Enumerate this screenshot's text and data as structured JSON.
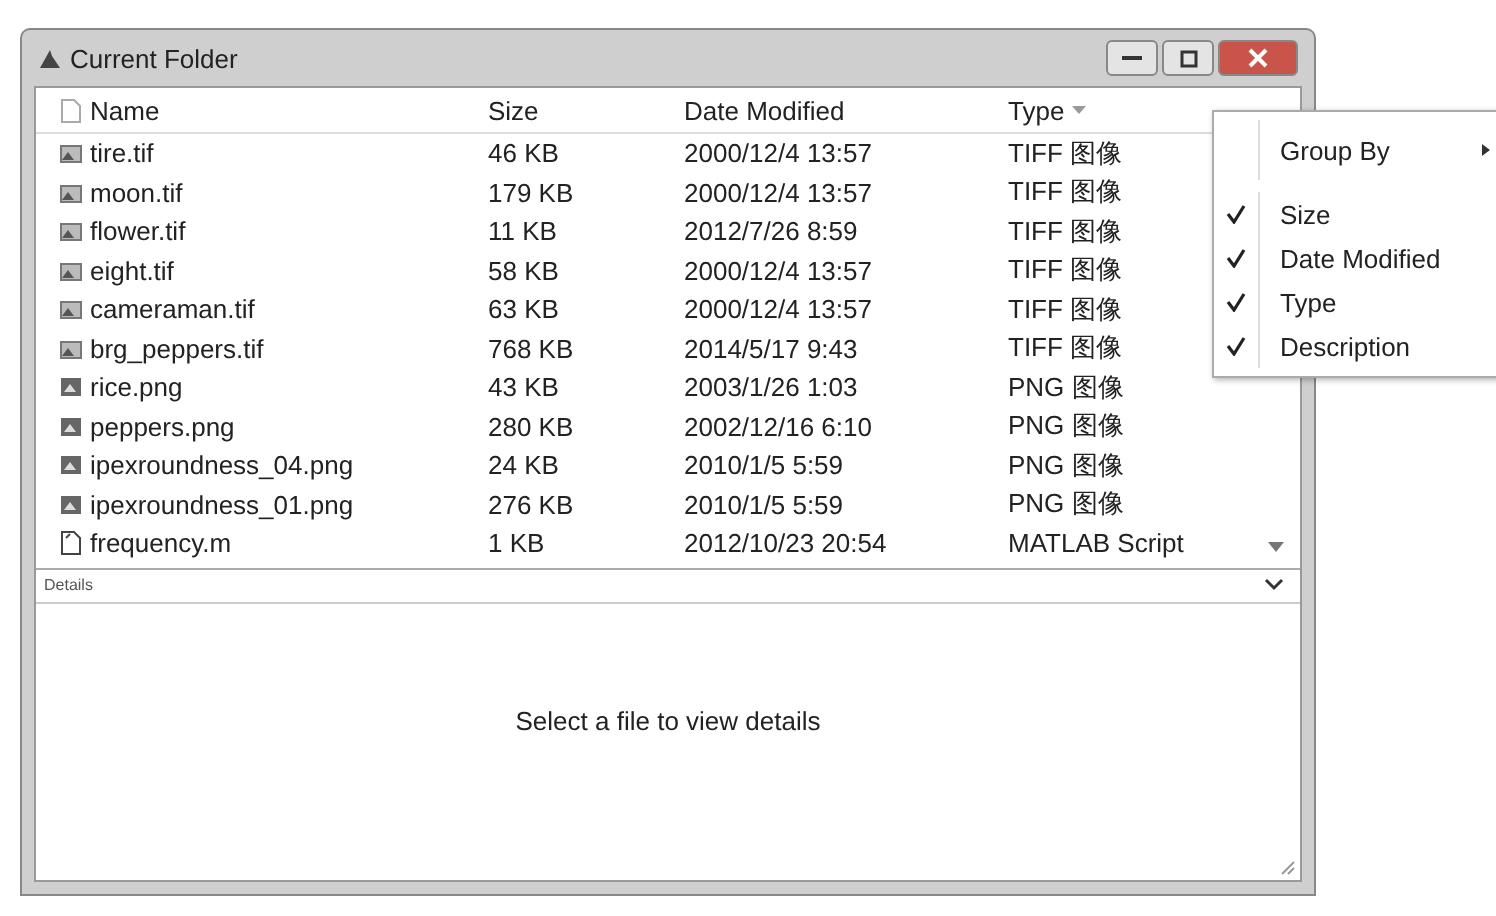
{
  "window": {
    "title": "Current Folder"
  },
  "table": {
    "columns": [
      "Name",
      "Size",
      "Date Modified",
      "Type"
    ],
    "rows": [
      {
        "kind": "tif",
        "name": "tire.tif",
        "size": "46 KB",
        "date": "2000/12/4 13:57",
        "type": "TIFF 图像"
      },
      {
        "kind": "tif",
        "name": "moon.tif",
        "size": "179 KB",
        "date": "2000/12/4 13:57",
        "type": "TIFF 图像"
      },
      {
        "kind": "tif",
        "name": "flower.tif",
        "size": "11 KB",
        "date": "2012/7/26 8:59",
        "type": "TIFF 图像"
      },
      {
        "kind": "tif",
        "name": "eight.tif",
        "size": "58 KB",
        "date": "2000/12/4 13:57",
        "type": "TIFF 图像"
      },
      {
        "kind": "tif",
        "name": "cameraman.tif",
        "size": "63 KB",
        "date": "2000/12/4 13:57",
        "type": "TIFF 图像"
      },
      {
        "kind": "tif",
        "name": "brg_peppers.tif",
        "size": "768 KB",
        "date": "2014/5/17 9:43",
        "type": "TIFF 图像"
      },
      {
        "kind": "png",
        "name": "rice.png",
        "size": "43 KB",
        "date": "2003/1/26 1:03",
        "type": "PNG 图像"
      },
      {
        "kind": "png",
        "name": "peppers.png",
        "size": "280 KB",
        "date": "2002/12/16 6:10",
        "type": "PNG 图像"
      },
      {
        "kind": "png",
        "name": "ipexroundness_04.png",
        "size": "24 KB",
        "date": "2010/1/5 5:59",
        "type": "PNG 图像"
      },
      {
        "kind": "png",
        "name": "ipexroundness_01.png",
        "size": "276 KB",
        "date": "2010/1/5 5:59",
        "type": "PNG 图像"
      },
      {
        "kind": "script",
        "name": "frequency.m",
        "size": "1 KB",
        "date": "2012/10/23 20:54",
        "type": "MATLAB Script"
      }
    ]
  },
  "details": {
    "title": "Details",
    "message": "Select a file to view details"
  },
  "context_menu": {
    "items": [
      {
        "kind": "submenu",
        "label": "Group By"
      },
      {
        "kind": "check",
        "label": "Size",
        "checked": true
      },
      {
        "kind": "check",
        "label": "Date Modified",
        "checked": true
      },
      {
        "kind": "check",
        "label": "Type",
        "checked": true
      },
      {
        "kind": "check",
        "label": "Description",
        "checked": true
      }
    ]
  }
}
